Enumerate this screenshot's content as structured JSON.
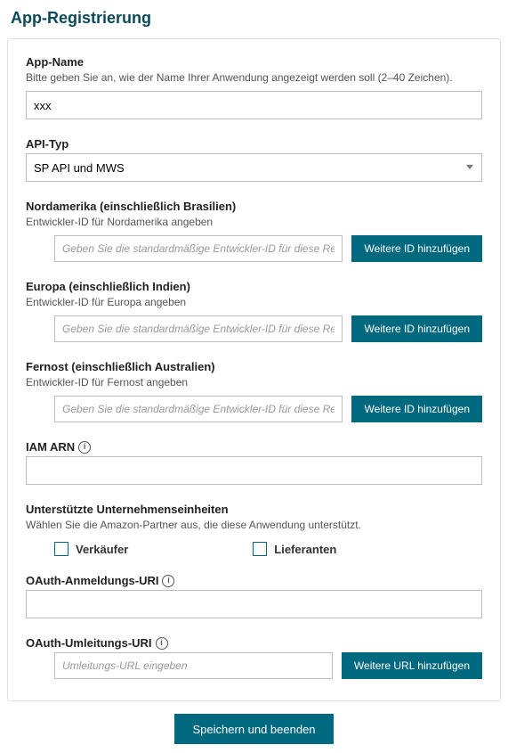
{
  "pageTitle": "App-Registrierung",
  "appName": {
    "label": "App-Name",
    "help": "Bitte geben Sie an, wie der Name Ihrer Anwendung angezeigt werden soll (2–40 Zeichen).",
    "value": "xxx"
  },
  "apiType": {
    "label": "API-Typ",
    "selected": "SP API und MWS"
  },
  "regions": {
    "na": {
      "label": "Nordamerika (einschließlich Brasilien)",
      "help": "Entwickler-ID für Nordamerika angeben",
      "placeholder": "Geben Sie die standardmäßige Entwickler-ID für diese Region an",
      "button": "Weitere ID hinzufügen"
    },
    "eu": {
      "label": "Europa (einschließlich Indien)",
      "help": "Entwickler-ID für Europa angeben",
      "placeholder": "Geben Sie die standardmäßige Entwickler-ID für diese Region an",
      "button": "Weitere ID hinzufügen"
    },
    "fe": {
      "label": "Fernost (einschließlich Australien)",
      "help": "Entwickler-ID für Fernost angeben",
      "placeholder": "Geben Sie die standardmäßige Entwickler-ID für diese Region an",
      "button": "Weitere ID hinzufügen"
    }
  },
  "iamArn": {
    "label": "IAM ARN"
  },
  "entities": {
    "label": "Unterstützte Unternehmenseinheiten",
    "help": "Wählen Sie die Amazon-Partner aus, die diese Anwendung unterstützt.",
    "sellers": "Verkäufer",
    "vendors": "Lieferanten"
  },
  "oauthLogin": {
    "label": "OAuth-Anmeldungs-URI"
  },
  "oauthRedirect": {
    "label": "OAuth-Umleitungs-URI",
    "placeholder": "Umleitungs-URL eingeben",
    "button": "Weitere URL hinzufügen"
  },
  "footer": {
    "save": "Speichern und beenden"
  }
}
